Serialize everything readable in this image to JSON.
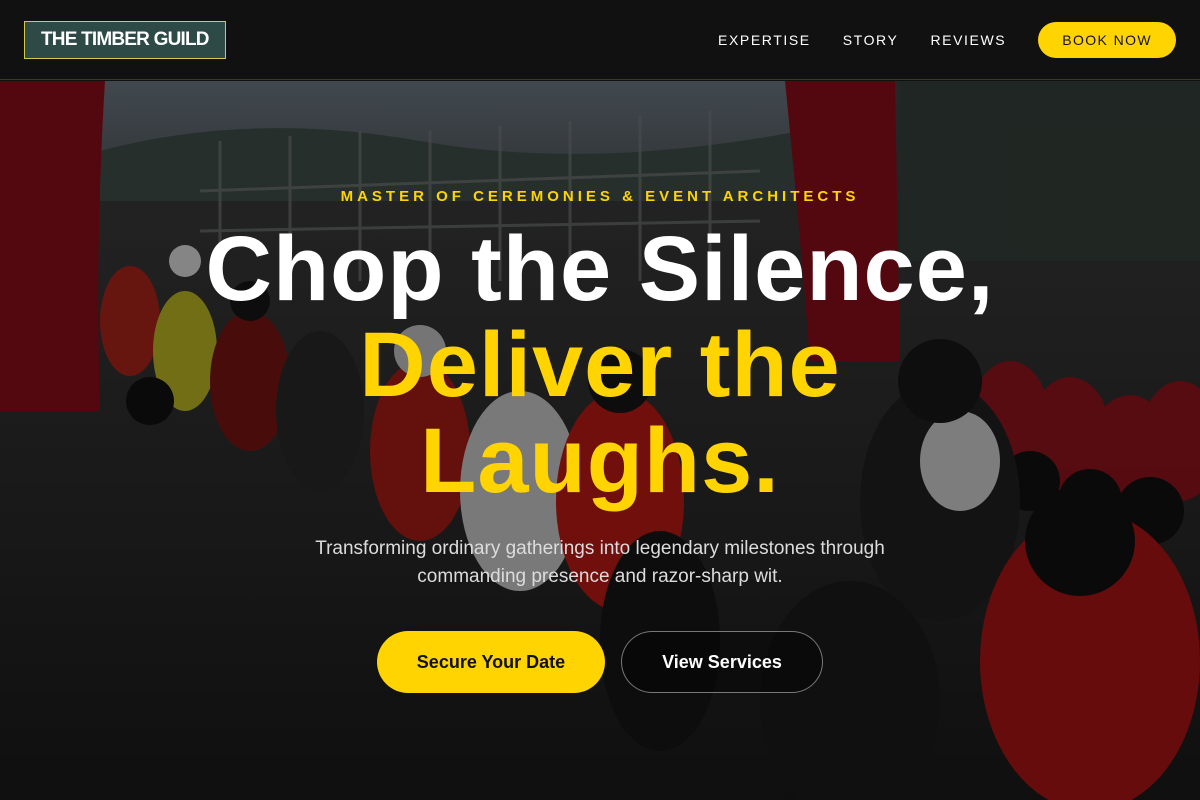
{
  "nav": {
    "logo_text": "THE TIMBER GUILD",
    "links": [
      {
        "label": "EXPERTISE"
      },
      {
        "label": "STORY"
      },
      {
        "label": "REVIEWS"
      }
    ],
    "cta_label": "BOOK NOW"
  },
  "hero": {
    "eyebrow": "MASTER OF CEREMONIES & EVENT ARCHITECTS",
    "headline_line1": "Chop the Silence,",
    "headline_line2": "Deliver the",
    "headline_line3": "Laughs.",
    "subtext": "Transforming ordinary gatherings into legendary milestones through commanding presence and razor-sharp wit.",
    "primary_button": "Secure Your Date",
    "secondary_button": "View Services",
    "background_image": "motorcycle-racing-paddock-photo"
  },
  "colors": {
    "accent": "#ffd400",
    "nav_bg": "#111111",
    "logo_bg": "#2d4a47",
    "logo_border": "#d4c84a",
    "text_light": "#ffffff"
  }
}
